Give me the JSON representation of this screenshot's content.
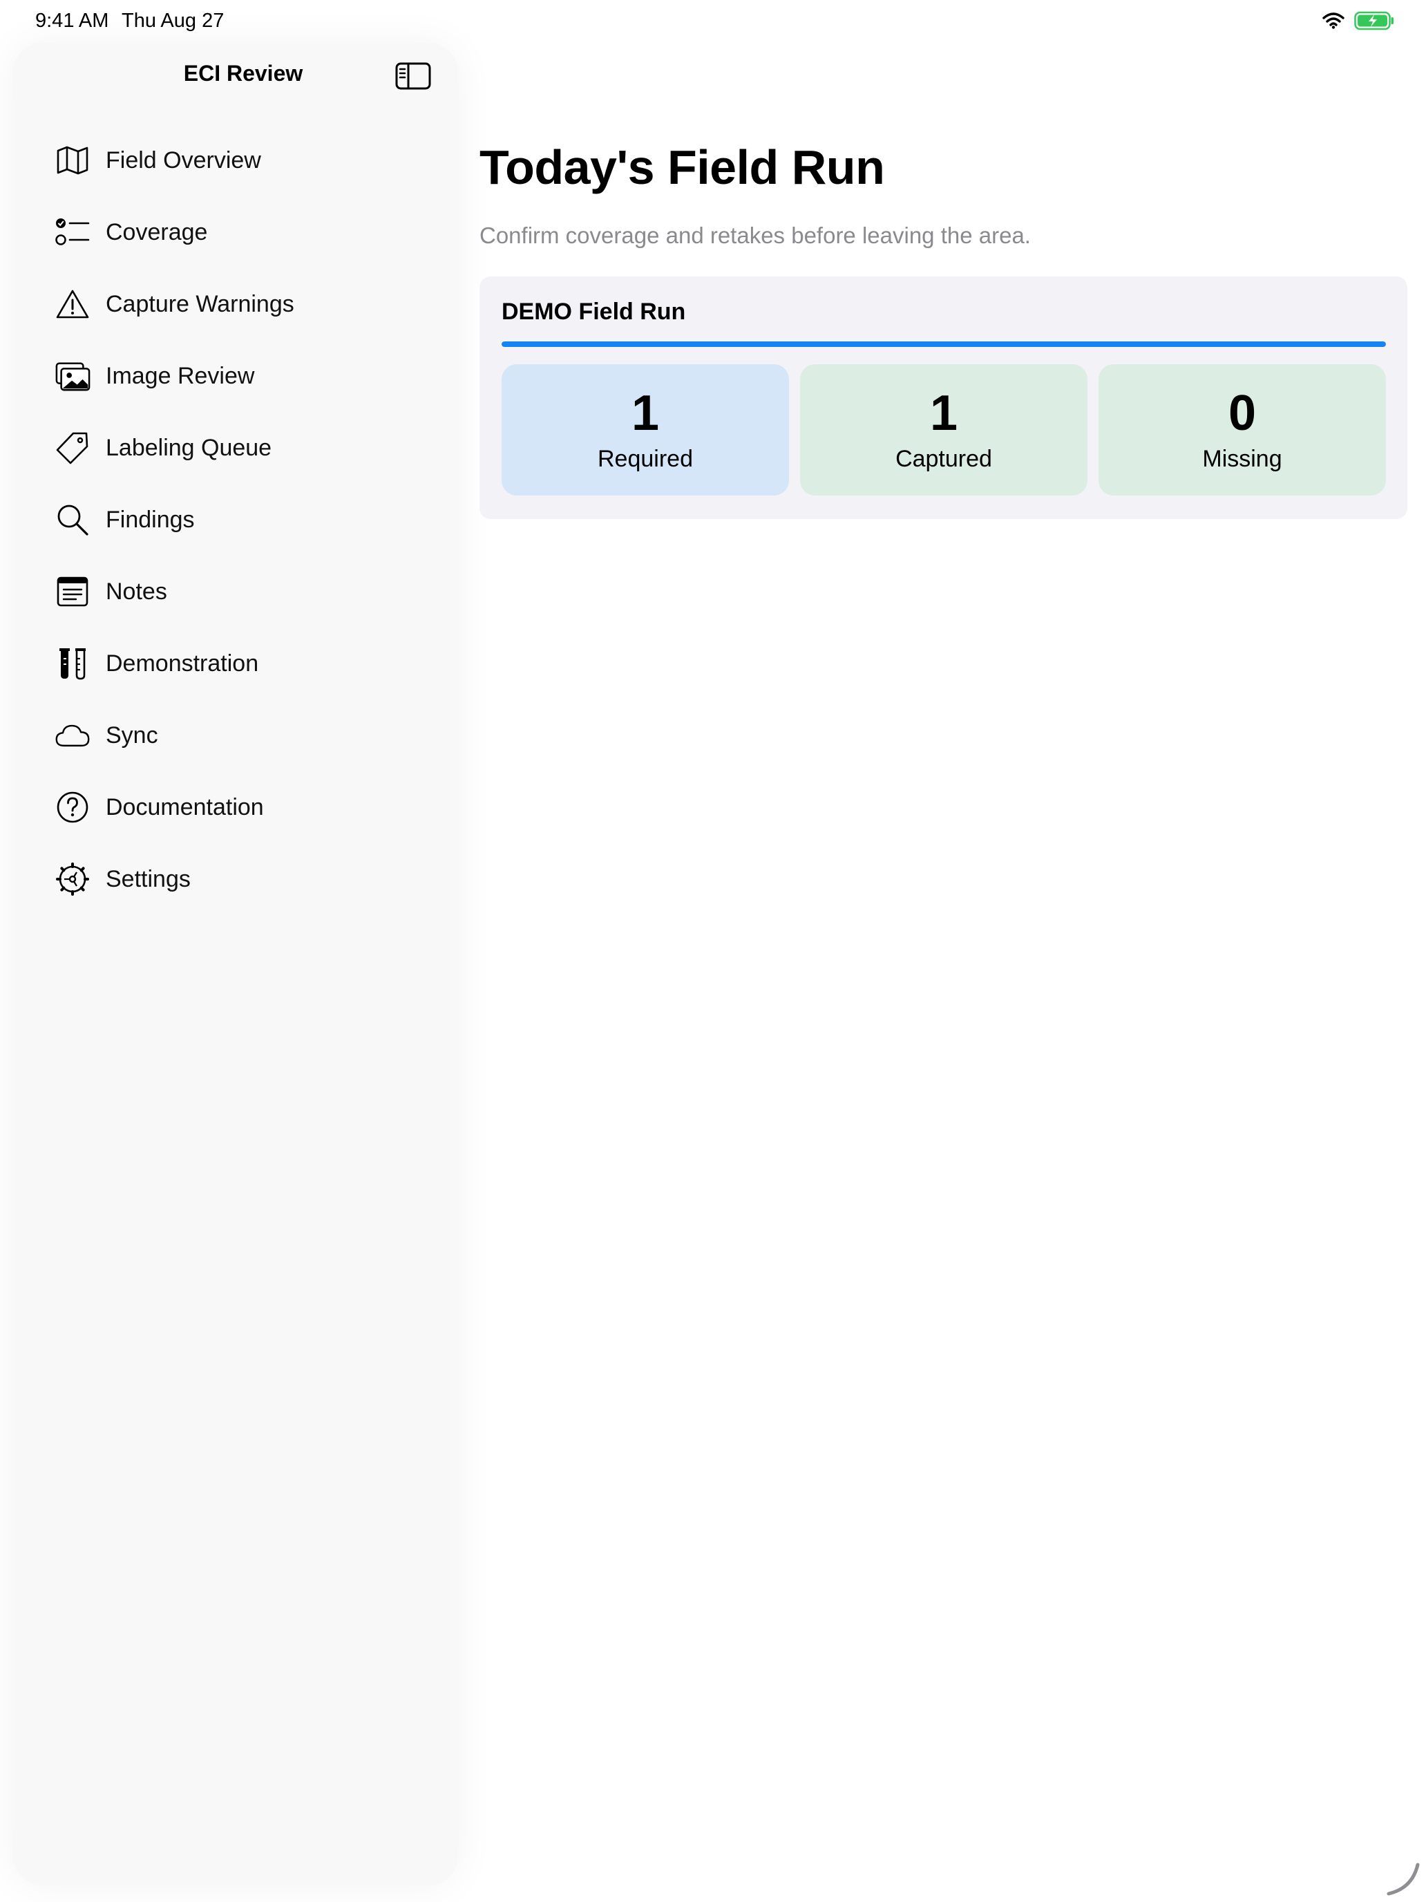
{
  "status_bar": {
    "time": "9:41 AM",
    "date": "Thu Aug 27",
    "battery_color": "#34c759"
  },
  "sidebar": {
    "title": "ECI Review",
    "items": [
      {
        "label": "Field Overview",
        "icon": "map-icon"
      },
      {
        "label": "Coverage",
        "icon": "checklist-icon"
      },
      {
        "label": "Capture Warnings",
        "icon": "warning-triangle-icon"
      },
      {
        "label": "Image Review",
        "icon": "photo-stack-icon"
      },
      {
        "label": "Labeling Queue",
        "icon": "tag-icon"
      },
      {
        "label": "Findings",
        "icon": "magnifier-icon"
      },
      {
        "label": "Notes",
        "icon": "notes-icon"
      },
      {
        "label": "Demonstration",
        "icon": "test-tubes-icon"
      },
      {
        "label": "Sync",
        "icon": "cloud-icon"
      },
      {
        "label": "Documentation",
        "icon": "question-circle-icon"
      },
      {
        "label": "Settings",
        "icon": "gear-icon"
      }
    ]
  },
  "main": {
    "title": "Today's Field Run",
    "subtitle": "Confirm coverage and retakes before leaving the area.",
    "card": {
      "title": "DEMO Field Run",
      "progress": 1.0,
      "accent_color": "#1683f2",
      "stats": {
        "required": {
          "value": "1",
          "label": "Required"
        },
        "captured": {
          "value": "1",
          "label": "Captured"
        },
        "missing": {
          "value": "0",
          "label": "Missing"
        }
      }
    }
  }
}
